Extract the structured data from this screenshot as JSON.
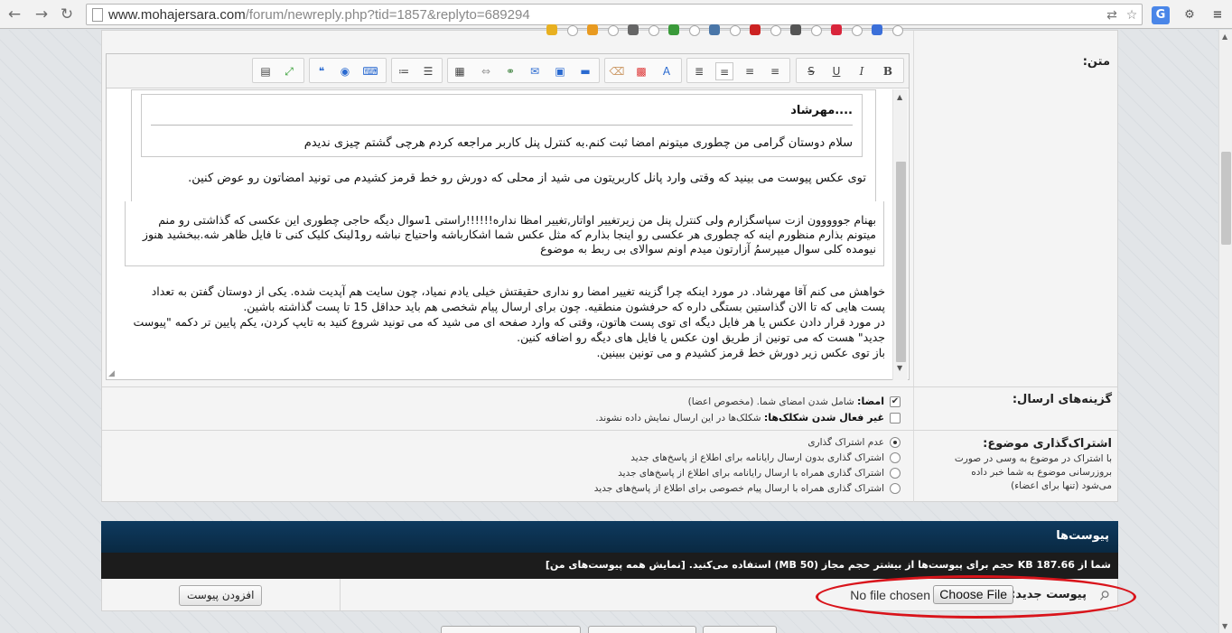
{
  "browser": {
    "url_host": "www.mohajersara.com",
    "url_path": "/forum/newreply.php?tid=1857&replyto=689294",
    "back_icon": "back-arrow-icon",
    "forward_icon": "forward-arrow-icon",
    "reload_icon": "reload-icon"
  },
  "form": {
    "message_label": "متن:",
    "editor": {
      "quote_author": "....مهرشاد",
      "quote_text": "سلام دوستان گرامی من چطوری میتونم امضا ثبت کنم.به کنترل پنل کاربر مراجعه کردم هرچی گشتم چیزی ندیدم",
      "quote_line": "توی عکس پیوست می بینید که وقتی وارد پانل کاربریتون می شید از محلی که دورش رو خط قرمز کشیدم می تونید امضاتون رو عوض کنین.",
      "quote2_text": "بهنام جووووون ازت سپاسگزارم ولی کنترل پنل من زیرتغییر اواتار,تغییر امظا نداره!!!!!!راستی 1سوال دیگه حاجی چطوری این عکسی که گذاشتی رو منم میتونم بذارم منظورم اینه که چطوری هر عکسی رو اینجا بذارم که مثل عکس شما اشکارباشه واحتیاج نباشه رو1لینک کلیک کنی تا فایل ظاهر شه.ببخشید هنوز نیومده کلی سوال میپرسمُ آزارتون میدم اونم سوالای بی ربط به موضوع",
      "reply_text_1": "خواهش می کنم آقا مهرشاد. در مورد اینکه چرا گزینه تغییر امضا رو نداری حقیقتش خیلی یادم نمیاد، چون سایت هم آپدیت شده. یکی از دوستان گفتن به تعداد پست هایی که تا الان گذاستین بستگی داره که حرفشون منطقیه. چون برای ارسال پیام شخصی هم باید حداقل 15 تا پست گذاشته باشین.",
      "reply_text_2": "در مورد قرار دادن عکس یا هر فایل دیگه ای توی پست هاتون، وقتی که وارد صفحه ای می شید که می تونید شروع کنید به تایپ کردن، یکم پایین تر دکمه \"پیوست جدید\" هست که می تونین از طریق اون عکس یا فایل های دیگه رو اضافه کنین.",
      "reply_text_3": "باز توی عکس زیر دورش خط قرمز کشیدم و می تونین ببینین."
    },
    "post_options": {
      "label": "گزینه‌های ارسال:",
      "signature_bold": "امضا:",
      "signature_desc": "شامل شدن امضای شما. (مخصوص اعضا)",
      "signature_checked": true,
      "smilies_bold": "غیر فعال شدن شکلک‌ها:",
      "smilies_desc": "شکلک‌ها در این ارسال نمایش داده نشوند.",
      "smilies_checked": false
    },
    "subscription": {
      "label": "اشتراک‌گذاری موضوع:",
      "desc": "با اشتراک در موضوع به وسی در صورت بروزرسانی موضوع به شما خبر داده می‌شود (تنها برای اعضاء)",
      "options": [
        "عدم اشتراک گذاری",
        "اشتراک گذاری بدون ارسال رایانامه برای اطلاع از پاسخ‌های جدید",
        "اشتراک گذاری همراه با ارسال رایانامه برای اطلاع از پاسخ‌های جدید",
        "اشتراک گذاری همراه با ارسال پیام خصوصی برای اطلاع از پاسخ‌های جدید"
      ],
      "selected_index": 0
    }
  },
  "attachments": {
    "title": "پیوست‌ها",
    "usage": "شما از 187.66 KB حجم برای پیوست‌ها از بیشتر حجم مجاز (50 MB) استفاده می‌کنید. [نمایش همه پیوست‌های من]",
    "new_label": "پیوست جدید:",
    "choose_file": "Choose File",
    "no_file": "No file chosen",
    "add_button": "افزودن پیوست"
  },
  "colors": {
    "attach_header": "#0f3a5f",
    "highlight_ellipse": "#d9141b"
  }
}
